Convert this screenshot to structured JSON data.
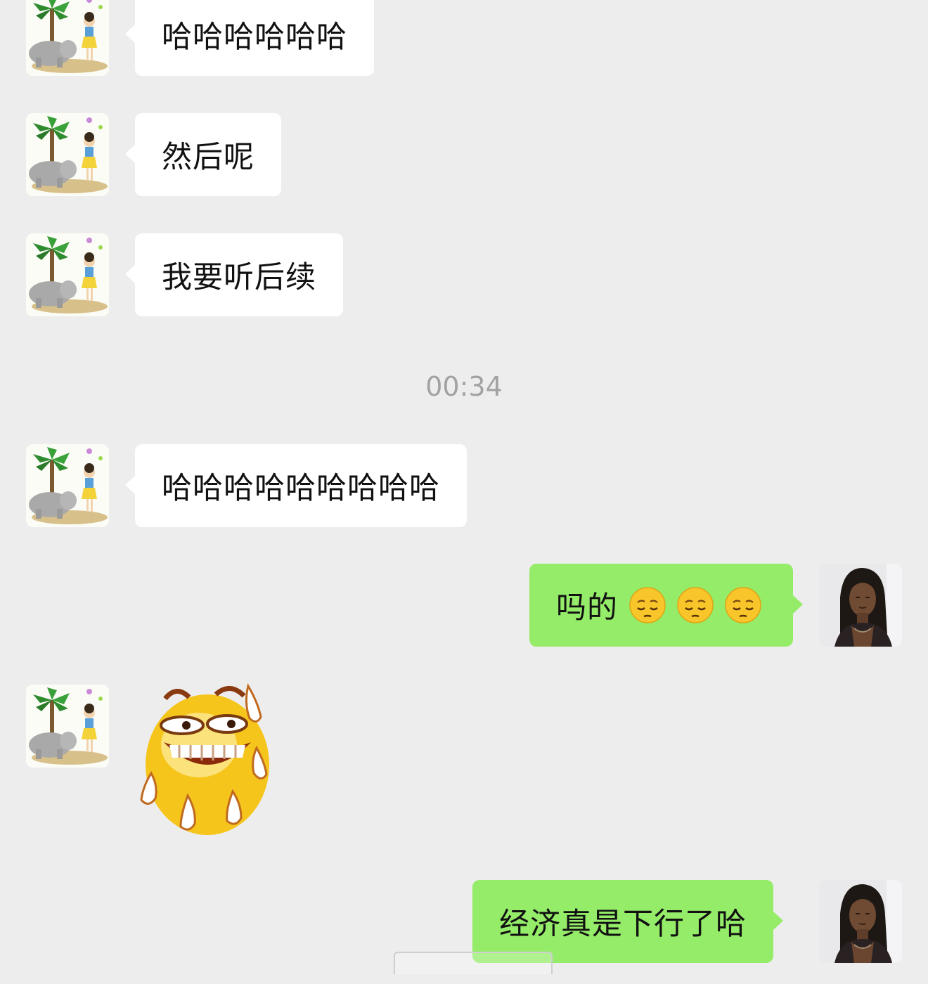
{
  "chat": {
    "timestamp": "00:34",
    "messages": [
      {
        "sender": "contact",
        "text": "哈哈哈哈哈哈"
      },
      {
        "sender": "contact",
        "text": "然后呢"
      },
      {
        "sender": "contact",
        "text": "我要听后续"
      },
      {
        "sender": "contact",
        "text": "哈哈哈哈哈哈哈哈哈"
      },
      {
        "sender": "me",
        "text": "吗的",
        "emojis": [
          "pensive-face-emoji",
          "pensive-face-emoji",
          "pensive-face-emoji"
        ]
      },
      {
        "sender": "contact",
        "sticker": "sweating-grin-sticker"
      },
      {
        "sender": "me",
        "text": "经济真是下行了哈"
      }
    ]
  },
  "avatars": {
    "contact": "palm-tree-elephant-girl-avatar",
    "me": "dark-haired-woman-avatar"
  },
  "colors": {
    "background": "#ededed",
    "incoming_bubble": "#ffffff",
    "outgoing_bubble": "#95ec69",
    "timestamp_text": "#a2a2a2"
  }
}
